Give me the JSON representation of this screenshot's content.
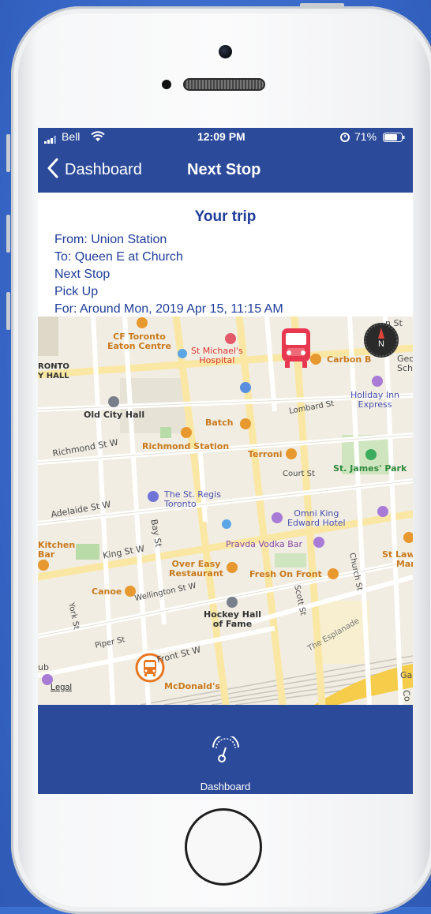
{
  "status_bar": {
    "carrier": "Bell",
    "time": "12:09 PM",
    "battery": "71%"
  },
  "nav": {
    "back_label": "Dashboard",
    "title": "Next Stop"
  },
  "trip": {
    "title": "Your trip",
    "from": "From: Union Station",
    "to": "To: Queen E at Church",
    "next_stop": "Next Stop",
    "pick_up": "Pick Up",
    "for": "For: Around Mon, 2019 Apr 15, 11:15 AM"
  },
  "map": {
    "labels": {
      "cf_toronto": "CF Toronto\nEaton Centre",
      "st_michaels": "St Michael's\nHospital",
      "carbon": "Carbon B",
      "toronto_hall": "RONTO\nY HALL",
      "old_city_hall": "Old City Hall",
      "batch": "Batch",
      "lombard": "Lombard St",
      "holiday_inn": "Holiday Inn\nExpress",
      "richmond_st": "Richmond St W",
      "richmond_station": "Richmond Station",
      "terroni": "Terroni",
      "court_st": "Court St",
      "st_james": "St. James' Park",
      "st_regis": "The St. Regis\nToronto",
      "adelaide": "Adelaide St W",
      "omni_king": "Omni King\nEdward Hotel",
      "bay_st": "Bay St",
      "pravda": "Pravda Vodka Bar",
      "kitchen_bar": "Kitchen\nBar",
      "king_st": "King St W",
      "over_easy": "Over Easy\nRestaurant",
      "fresh_on_front": "Fresh On Front",
      "church_st": "Church St",
      "st_law": "St Law\nMar",
      "canoe": "Canoe",
      "wellington": "Wellington St W",
      "york_st": "York St",
      "hockey_hall": "Hockey Hall\nof Fame",
      "scott_st": "Scott St",
      "esplanade": "The Esplanade",
      "piper_st": "Piper St",
      "front_st": "Front St W",
      "mcdonalds": "McDonald's",
      "ub": "ub",
      "ga": "Ga",
      "co": "Co",
      "n_st": "n St",
      "geo": "Geo\nScho",
      "compass_n": "N"
    },
    "legal": "Legal",
    "colors": {
      "bus_stop_red": "#e8384f",
      "current_stop_orange": "#e87722"
    }
  },
  "tabbar": {
    "dashboard_label": "Dashboard",
    "icon": "speedometer-icon"
  },
  "colors": {
    "header_blue": "#2c4a9a",
    "text_blue": "#1f3d99"
  }
}
